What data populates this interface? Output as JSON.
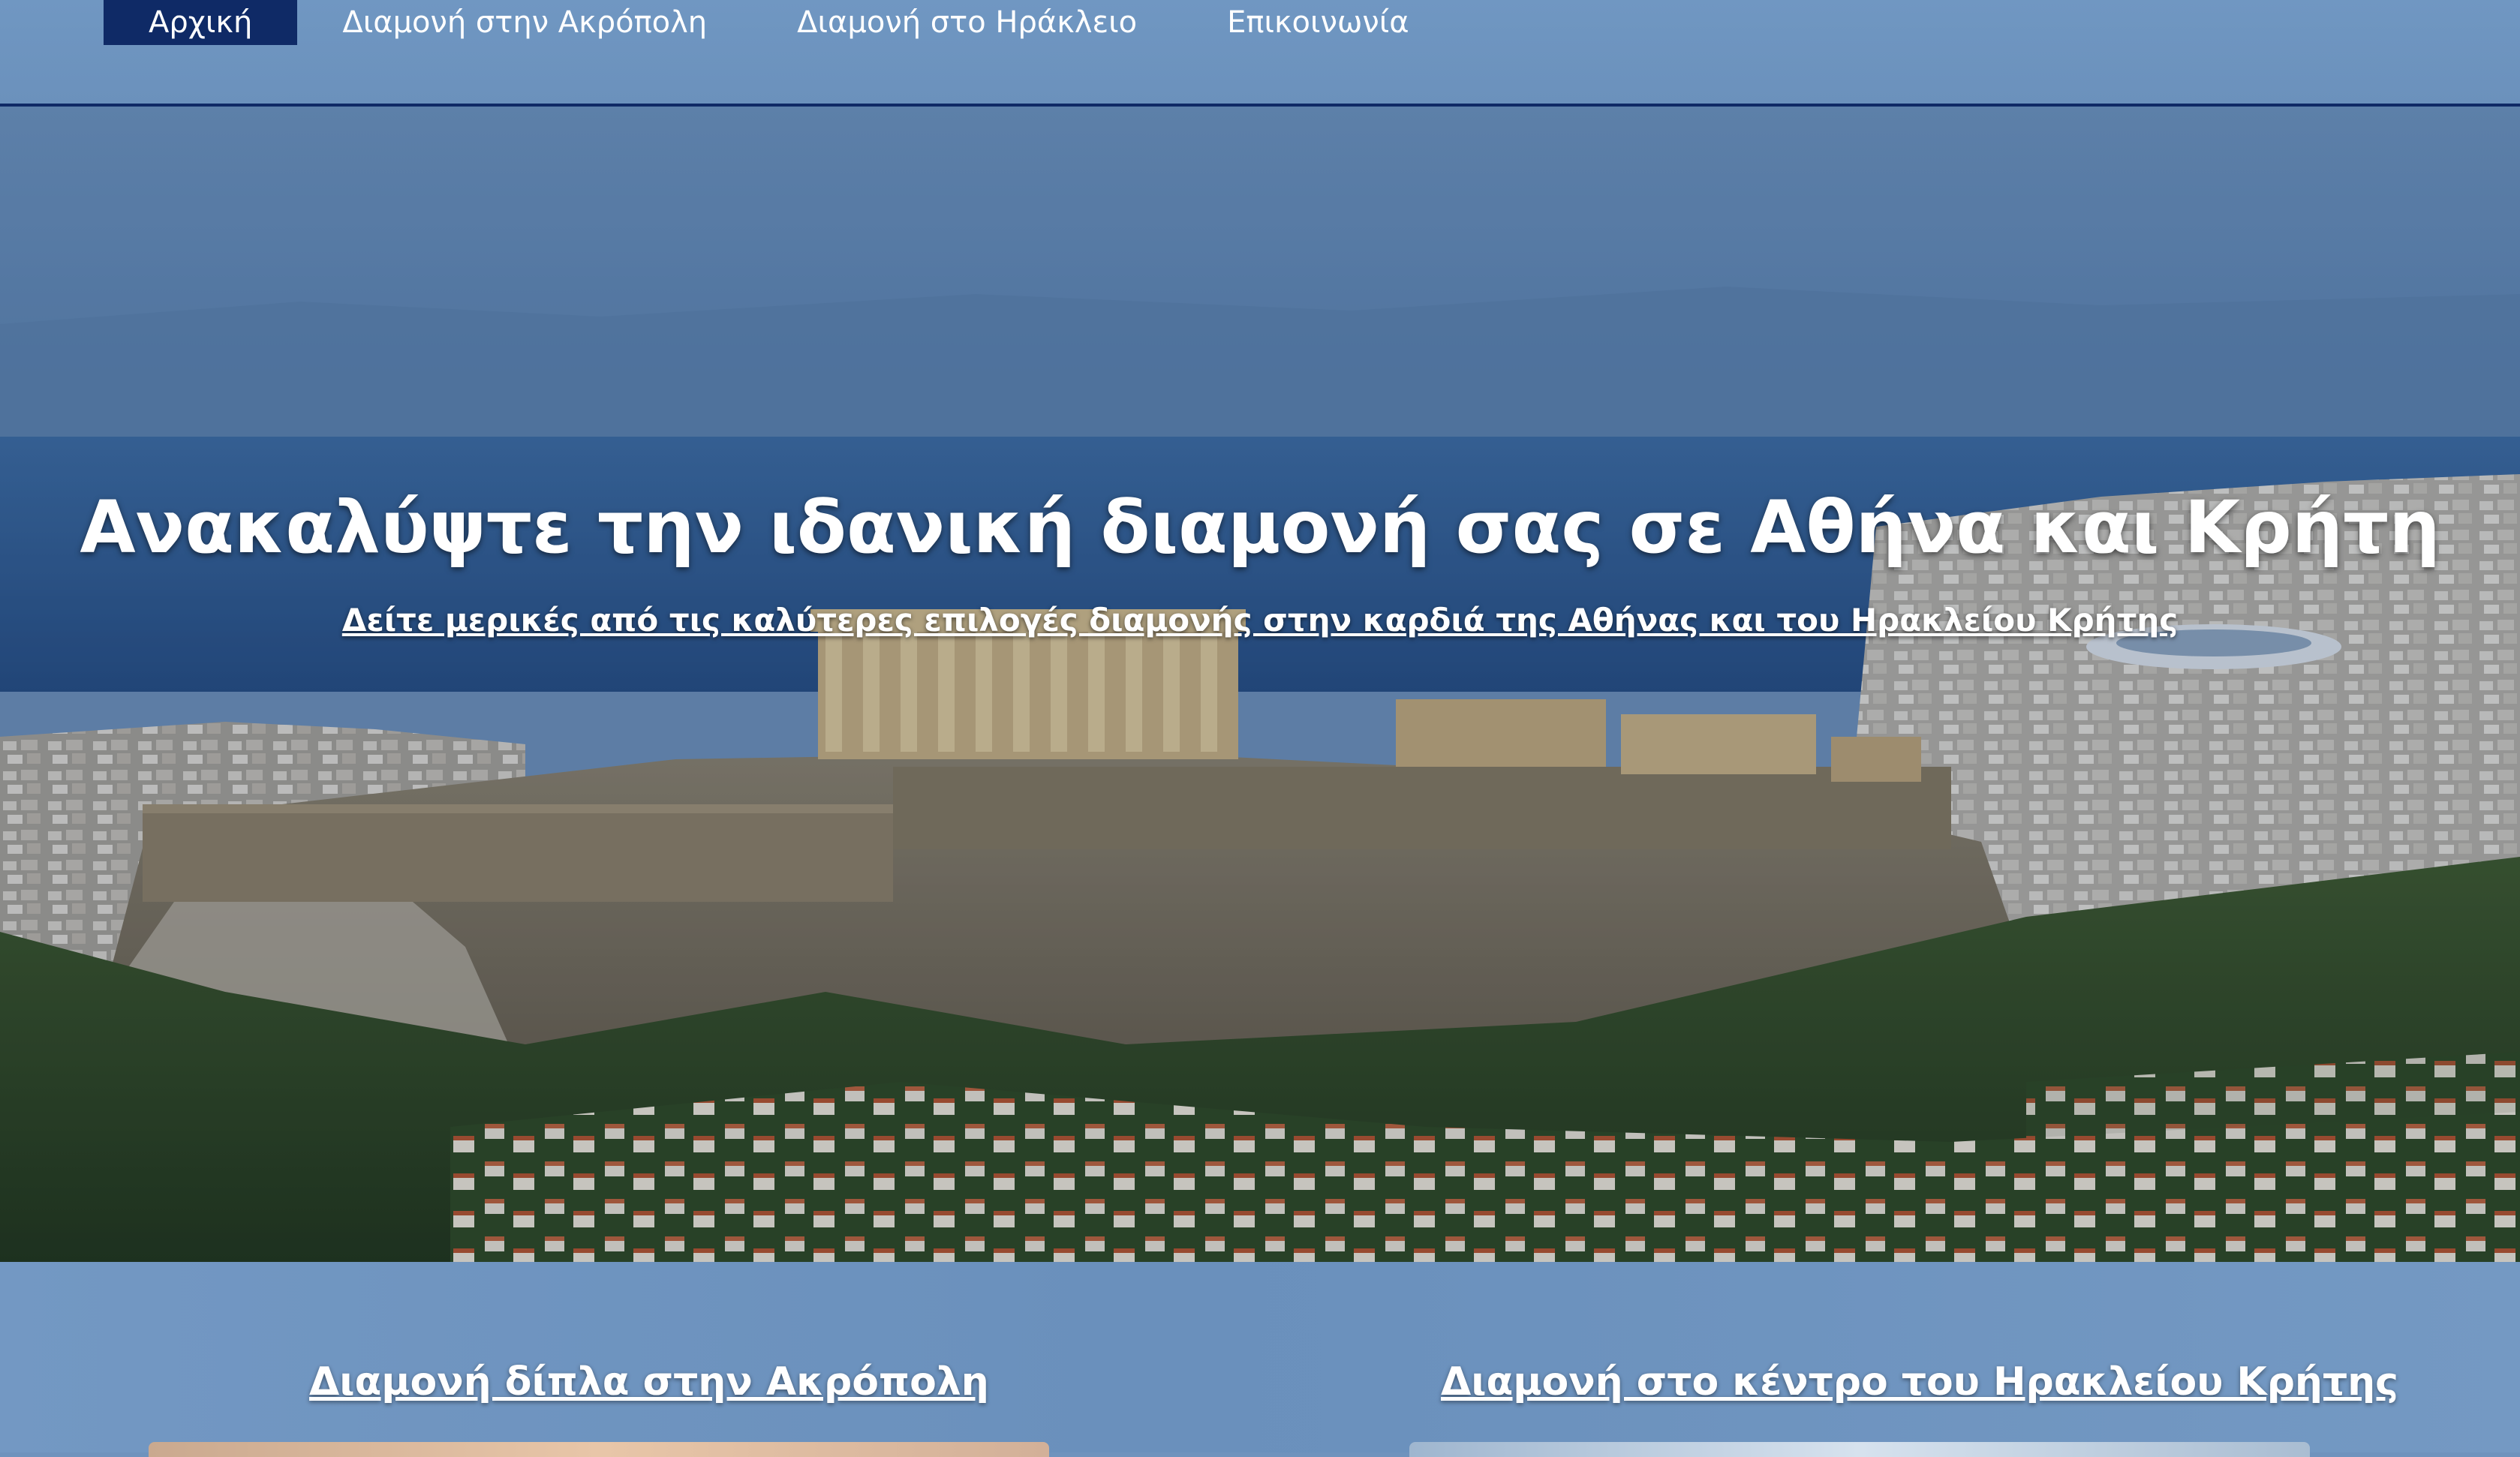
{
  "nav": {
    "items": [
      {
        "label": "Αρχική",
        "active": true
      },
      {
        "label": "Διαμονή στην Ακρόπολη",
        "active": false
      },
      {
        "label": "Διαμονή στο Ηράκλειο",
        "active": false
      },
      {
        "label": "Επικοινωνία",
        "active": false
      }
    ],
    "active_color": "#0f2a66"
  },
  "hero": {
    "title": "Ανακαλύψτε την ιδανική διαμονή σας σε Αθήνα και Κρήτη",
    "subtitle": "Δείτε μερικές από τις καλύτερες επιλογές διαμονής στην καρδιά της Αθήνας και του Ηρακλείου Κρήτης"
  },
  "sections": {
    "left_title": "Διαμονή δίπλα στην Ακρόπολη",
    "right_title": "Διαμονή στο κέντρο του Ηρακλείου Κρήτης"
  },
  "colors": {
    "background": "#6f93bd",
    "divider": "#0f2a66",
    "text": "#ffffff"
  }
}
